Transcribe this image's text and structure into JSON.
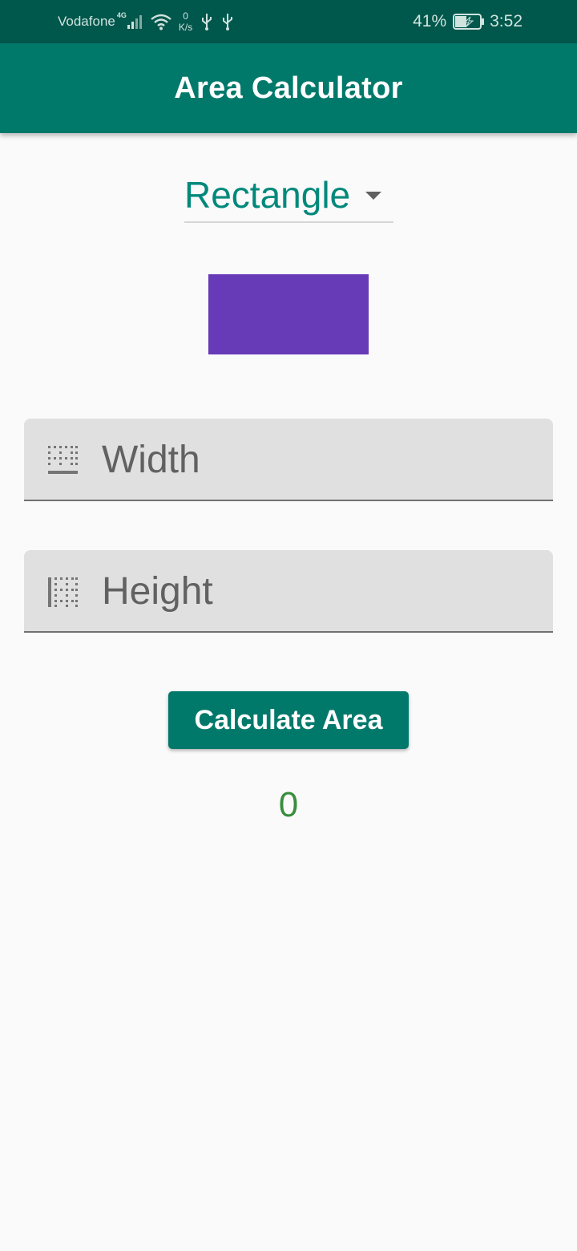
{
  "status_bar": {
    "carrier": "Vodafone",
    "network": "4G",
    "speed_value": "0",
    "speed_unit": "K/s",
    "battery_percent": "41%",
    "time": "3:52"
  },
  "app_bar": {
    "title": "Area Calculator"
  },
  "shape_selector": {
    "selected": "Rectangle"
  },
  "preview": {
    "color": "#673ab7"
  },
  "fields": {
    "width_placeholder": "Width",
    "height_placeholder": "Height"
  },
  "actions": {
    "calculate_label": "Calculate Area"
  },
  "result": {
    "value": "0"
  },
  "colors": {
    "status_bar": "#00574b",
    "primary": "#00796b",
    "accent_text": "#00897b",
    "result_text": "#388e3c",
    "field_bg": "#e0e0e0"
  }
}
